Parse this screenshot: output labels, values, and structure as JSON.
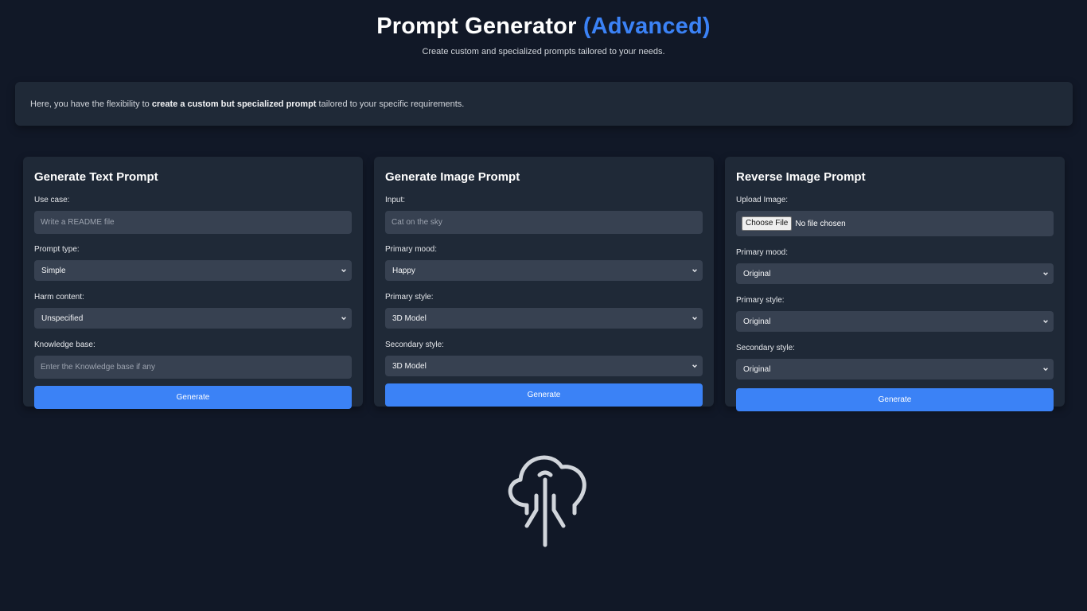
{
  "header": {
    "title": "Prompt Generator",
    "title_accent": "(Advanced)",
    "subtitle": "Create custom and specialized prompts tailored to your needs."
  },
  "intro": {
    "prefix": "Here, you have the flexibility to ",
    "emphasis": "create a custom but specialized prompt",
    "suffix": " tailored to your specific requirements."
  },
  "text_prompt": {
    "title": "Generate Text Prompt",
    "use_case_label": "Use case:",
    "use_case_placeholder": "Write a README file",
    "prompt_type_label": "Prompt type:",
    "prompt_type_value": "Simple",
    "harm_label": "Harm content:",
    "harm_value": "Unspecified",
    "kb_label": "Knowledge base:",
    "kb_placeholder": "Enter the Knowledge base if any",
    "button": "Generate"
  },
  "image_prompt": {
    "title": "Generate Image Prompt",
    "input_label": "Input:",
    "input_placeholder": "Cat on the sky",
    "mood_label": "Primary mood:",
    "mood_value": "Happy",
    "style_label": "Primary style:",
    "style_value": "3D Model",
    "secondary_label": "Secondary style:",
    "secondary_value": "3D Model",
    "button": "Generate"
  },
  "reverse_prompt": {
    "title": "Reverse Image Prompt",
    "upload_label": "Upload Image:",
    "choose_file": "Choose File",
    "file_status": "No file chosen",
    "mood_label": "Primary mood:",
    "mood_value": "Original",
    "style_label": "Primary style:",
    "style_value": "Original",
    "secondary_label": "Secondary style:",
    "secondary_value": "Original",
    "button": "Generate"
  },
  "colors": {
    "background": "#111827",
    "card": "#1f2937",
    "input": "#374151",
    "accent": "#3b82f6"
  },
  "icons": {
    "select_arrow": "chevron-down-icon",
    "logo": "cloud-logo-icon"
  }
}
